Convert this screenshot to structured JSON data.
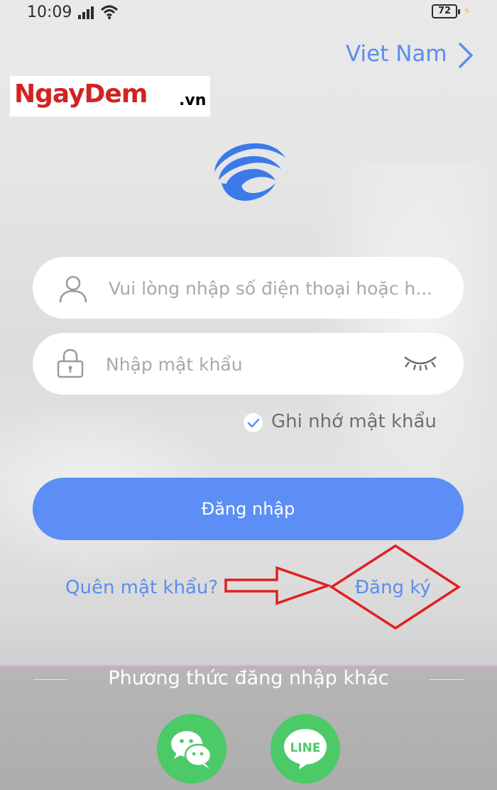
{
  "status": {
    "time": "10:09",
    "battery": "72"
  },
  "header": {
    "region": "Viet Nam"
  },
  "watermark": {
    "name": "NgayDem",
    "tld": ".vn"
  },
  "form": {
    "phone_placeholder": "Vui lòng nhập số điện thoại hoặc h...",
    "password_placeholder": "Nhập mật khẩu",
    "remember_label": "Ghi nhớ mật khẩu",
    "login_label": "Đăng nhập",
    "forgot_label": "Quên mật khẩu?",
    "register_label": "Đăng ký"
  },
  "alt_login": {
    "title": "Phương thức đăng nhập khác",
    "line_text": "LINE"
  },
  "colors": {
    "accent": "#5c8ef5",
    "link": "#5b8def",
    "social_green": "#4cca68",
    "annotation_red": "#e02020"
  },
  "icons": [
    "signal-icon",
    "wifi-icon",
    "battery-icon",
    "charging-icon",
    "chevron-right-icon",
    "app-logo-icon",
    "user-icon",
    "lock-icon",
    "eye-closed-icon",
    "check-icon",
    "wechat-icon",
    "line-icon"
  ]
}
